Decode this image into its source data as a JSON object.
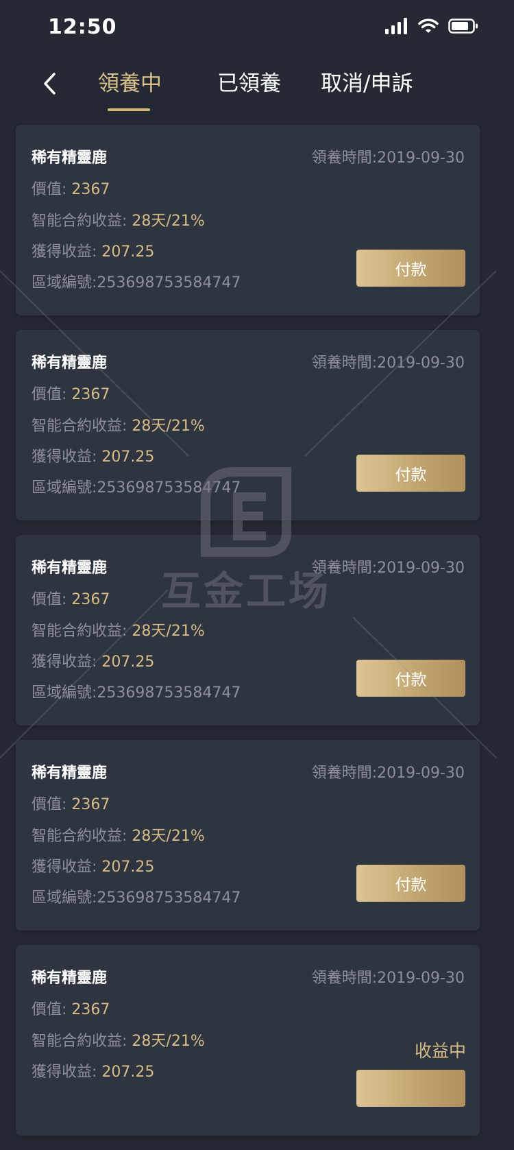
{
  "status_bar": {
    "time": "12:50",
    "icons": [
      "signal-icon",
      "wifi-icon",
      "battery-icon"
    ]
  },
  "nav": {
    "back_icon": "chevron-left-icon",
    "tabs": [
      {
        "label": "領養中",
        "active": true
      },
      {
        "label": "已領養",
        "active": false
      },
      {
        "label": "取消/申訴",
        "active": false
      }
    ]
  },
  "cards": [
    {
      "name": "稀有精靈鹿",
      "date": "領養時間:2019-09-30",
      "value_label": "價值:",
      "value": "2367",
      "contract_label": "智能合約收益:",
      "contract": "28天/21%",
      "earned_label": "獲得收益:",
      "earned": "207.25",
      "region": "區域編號:253698753584747",
      "button": "付款"
    },
    {
      "name": "稀有精靈鹿",
      "date": "領養時間:2019-09-30",
      "value_label": "價值:",
      "value": "2367",
      "contract_label": "智能合約收益:",
      "contract": "28天/21%",
      "earned_label": "獲得收益:",
      "earned": "207.25",
      "region": "區域編號:253698753584747",
      "button": "付款"
    },
    {
      "name": "稀有精靈鹿",
      "date": "領養時間:2019-09-30",
      "value_label": "價值:",
      "value": "2367",
      "contract_label": "智能合約收益:",
      "contract": "28天/21%",
      "earned_label": "獲得收益:",
      "earned": "207.25",
      "region": "區域編號:253698753584747",
      "button": "付款"
    },
    {
      "name": "稀有精靈鹿",
      "date": "領養時間:2019-09-30",
      "value_label": "價值:",
      "value": "2367",
      "contract_label": "智能合約收益:",
      "contract": "28天/21%",
      "earned_label": "獲得收益:",
      "earned": "207.25",
      "region": "區域編號:253698753584747",
      "button": "付款"
    },
    {
      "name": "稀有精靈鹿",
      "date": "領養時間:2019-09-30",
      "value_label": "價值:",
      "value": "2367",
      "contract_label": "智能合約收益:",
      "contract": "28天/21%",
      "earned_label": "獲得收益:",
      "earned": "207.25",
      "status": "收益中",
      "button": ""
    }
  ],
  "watermark": {
    "text": "互金工场"
  },
  "colors": {
    "background": "#252934",
    "card": "#2f3441",
    "accent_gold": "#d6bd86",
    "muted_text": "#8c909b"
  }
}
